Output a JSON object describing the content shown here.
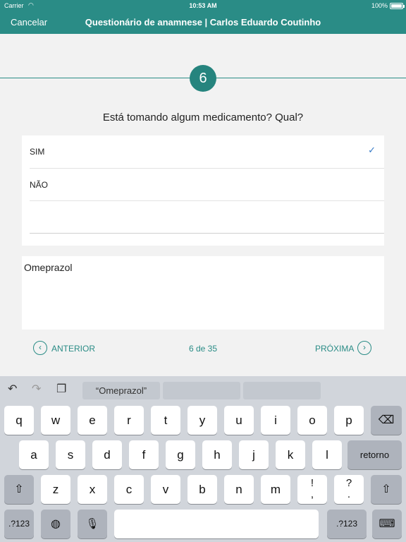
{
  "status": {
    "carrier": "Carrier",
    "time": "10:53 AM",
    "battery": "100%"
  },
  "nav": {
    "cancel": "Cancelar",
    "title": "Questionário de anamnese | Carlos Eduardo Coutinho"
  },
  "question": {
    "number": "6",
    "text": "Está tomando algum medicamento? Qual?"
  },
  "options": [
    {
      "label": "SIM",
      "selected": true
    },
    {
      "label": "NÃO",
      "selected": false
    }
  ],
  "answer": {
    "value": "Omeprazol"
  },
  "pager": {
    "prev": "ANTERIOR",
    "count": "6 de 35",
    "next": "PRÓXIMA"
  },
  "keyboard": {
    "suggestions": [
      "“Omeprazol”",
      "",
      ""
    ],
    "row1": [
      "q",
      "w",
      "e",
      "r",
      "t",
      "y",
      "u",
      "i",
      "o",
      "p"
    ],
    "row2": [
      "a",
      "s",
      "d",
      "f",
      "g",
      "h",
      "j",
      "k",
      "l"
    ],
    "row3": [
      "z",
      "x",
      "c",
      "v",
      "b",
      "n",
      "m"
    ],
    "return": "retorno",
    "num": ".?123",
    "punct1": "!,",
    "punct2": "?."
  },
  "colors": {
    "accent": "#2a8c86",
    "check": "#3478c6"
  }
}
